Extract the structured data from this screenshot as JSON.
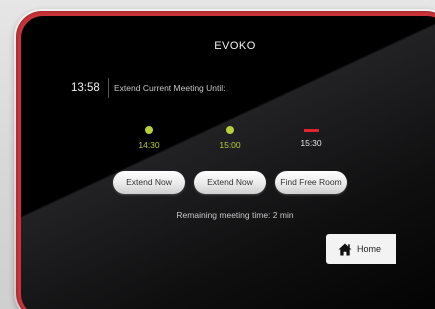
{
  "device": {
    "brand": "EVOKO",
    "frame_color": "#c9343a"
  },
  "header": {
    "clock": "13:58",
    "prompt": "Extend Current Meeting Until:"
  },
  "time_slots": [
    {
      "label": "14:30",
      "status": "available",
      "indicator": "dot",
      "color": "#b7cf3a"
    },
    {
      "label": "15:00",
      "status": "available",
      "indicator": "dot",
      "color": "#b7cf3a"
    },
    {
      "label": "15:30",
      "status": "unavailable",
      "indicator": "bar",
      "color": "#e0242e"
    }
  ],
  "actions": [
    {
      "label": "Extend Now"
    },
    {
      "label": "Extend Now"
    },
    {
      "label": "Find Free Room"
    }
  ],
  "status": {
    "remaining": "Remaining meeting time: 2 min"
  },
  "nav": {
    "home_label": "Home",
    "home_icon": "home-icon"
  }
}
